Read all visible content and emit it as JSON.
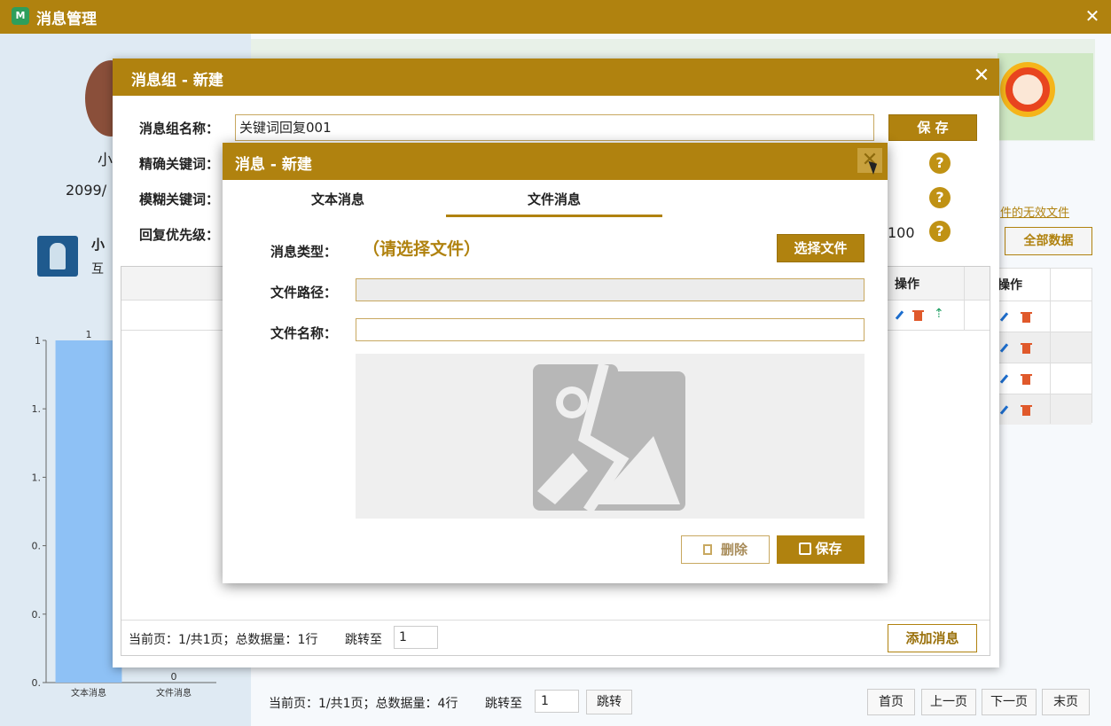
{
  "window": {
    "title": "消息管理",
    "icon_glyph": "M",
    "close_glyph": "✕"
  },
  "left": {
    "name_fragment": "小",
    "date_fragment": "2099/",
    "user_name_fragment": "小",
    "user_desc_fragment": "互",
    "chart_data": {
      "type": "bar",
      "categories": [
        "文本消息",
        "文件消息"
      ],
      "values": [
        1,
        0
      ],
      "value_labels": [
        "1",
        "0"
      ],
      "y_tick_labels": [
        "1",
        "1.",
        "1.",
        "0.",
        "0.",
        "0."
      ],
      "ylim": [
        0,
        1
      ],
      "bar_color": "#8ec1f5"
    }
  },
  "right": {
    "invalid_files_link": "件的无效文件",
    "all_data_button": "全部数据",
    "ops_header": "操作",
    "rows": 4
  },
  "bottom": {
    "page_info": "当前页：1/共1页；总数据量：4行",
    "jump_label": "跳转至",
    "jump_value": "1",
    "jump_button": "跳转",
    "first": "首页",
    "prev": "上一页",
    "next": "下一页",
    "last": "末页"
  },
  "group_dialog": {
    "title": "消息组 - 新建",
    "close_glyph": "✕",
    "name_label": "消息组名称：",
    "name_value": "关键词回复001",
    "save_button": "保 存",
    "exact_label": "精确关键词：",
    "fuzzy_label": "模糊关键词：",
    "priority_label": "回复优先级：",
    "priority_value_fragment": "100",
    "help_glyph": "?",
    "ops_header": "操作",
    "page_info": "当前页：1/共1页；总数据量：1行",
    "jump_label": "跳转至",
    "jump_value": "1",
    "add_button": "添加消息"
  },
  "message_dialog": {
    "title": "消息 - 新建",
    "close_glyph": "✕",
    "tabs": [
      {
        "label": "文本消息",
        "active": false
      },
      {
        "label": "文件消息",
        "active": true
      }
    ],
    "type_label": "消息类型：",
    "type_hint": "（请选择文件）",
    "choose_file_button": "选择文件",
    "path_label": "文件路径：",
    "path_value": "",
    "filename_label": "文件名称：",
    "filename_value": "",
    "delete_button": "删除",
    "save_button": "保存"
  }
}
